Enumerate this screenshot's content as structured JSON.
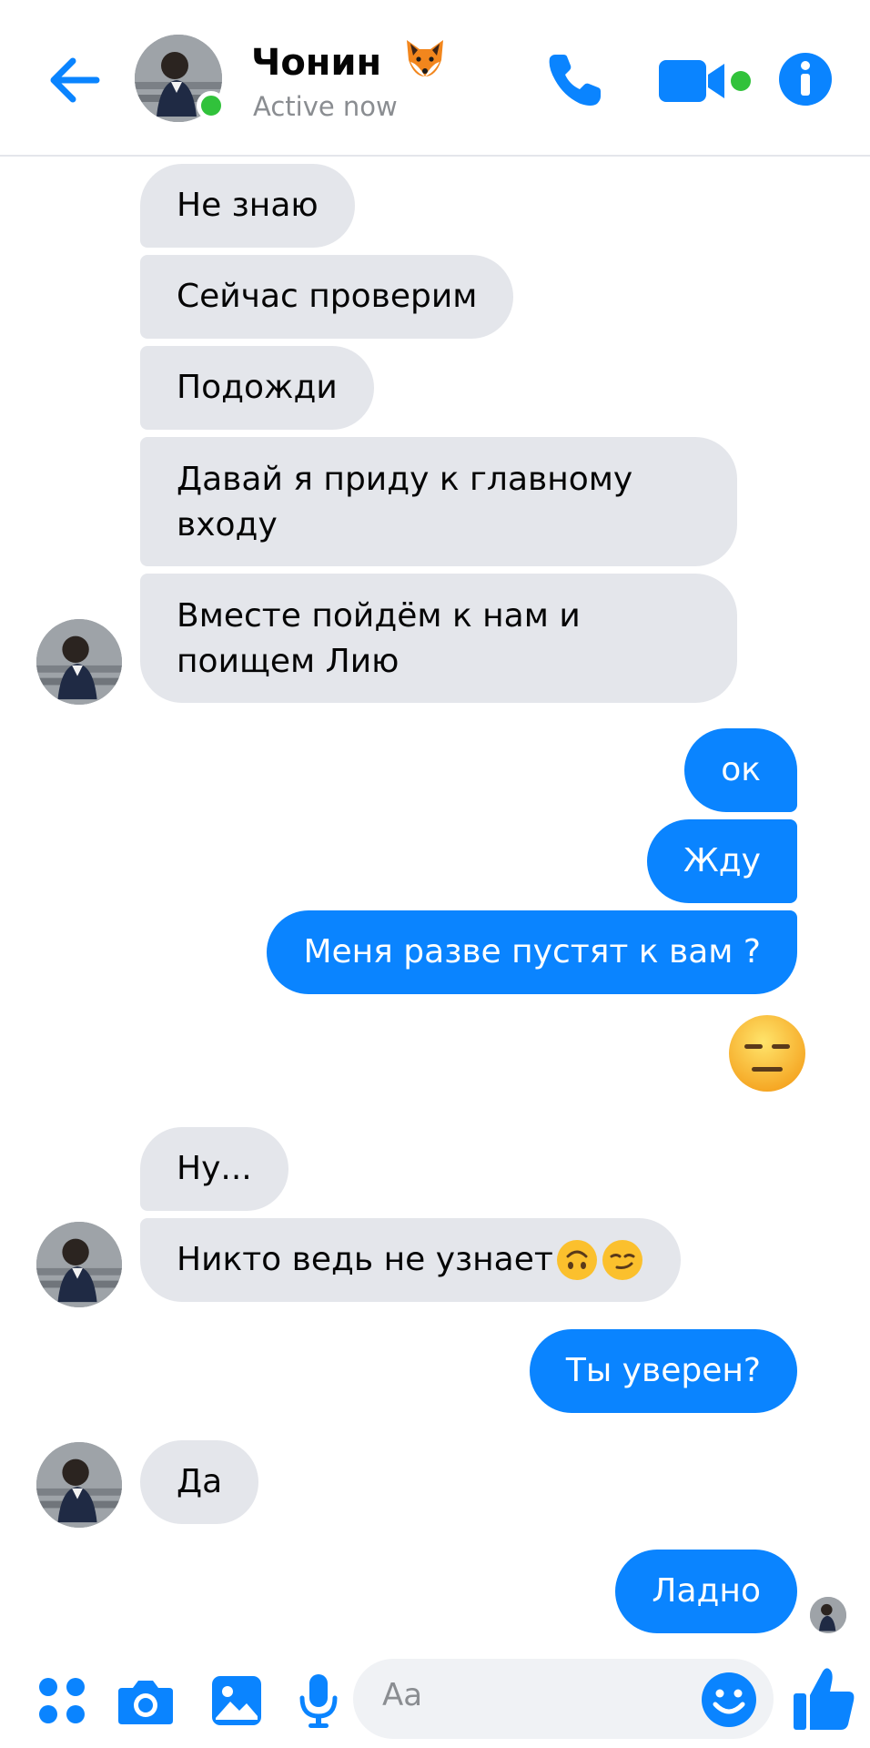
{
  "header": {
    "contact_name": "Чонин",
    "contact_status": "Active now"
  },
  "messages": [
    {
      "from": "them",
      "text": "Не знаю"
    },
    {
      "from": "them",
      "text": "Сейчас проверим"
    },
    {
      "from": "them",
      "text": "Подожди"
    },
    {
      "from": "them",
      "text": "Давай я приду к главному входу"
    },
    {
      "from": "them",
      "text": "Вместе пойдём к нам и поищем Лию"
    },
    {
      "from": "me",
      "text": "ок"
    },
    {
      "from": "me",
      "text": "Жду"
    },
    {
      "from": "me",
      "text": "Меня разве пустят к вам ?"
    },
    {
      "from": "me",
      "emoji": "expressionless-face"
    },
    {
      "from": "them",
      "text": "Ну..."
    },
    {
      "from": "them",
      "text": "Никто ведь не узнает",
      "emojis": [
        "upside-down-face",
        "smirking-face"
      ]
    },
    {
      "from": "me",
      "text": "Ты уверен?"
    },
    {
      "from": "them",
      "text": "Да"
    },
    {
      "from": "me",
      "text": "Ладно"
    }
  ],
  "composer": {
    "placeholder": "Aa"
  },
  "colors": {
    "accent": "#0a84ff",
    "received_bubble": "#e4e6eb",
    "online": "#31c23b"
  }
}
